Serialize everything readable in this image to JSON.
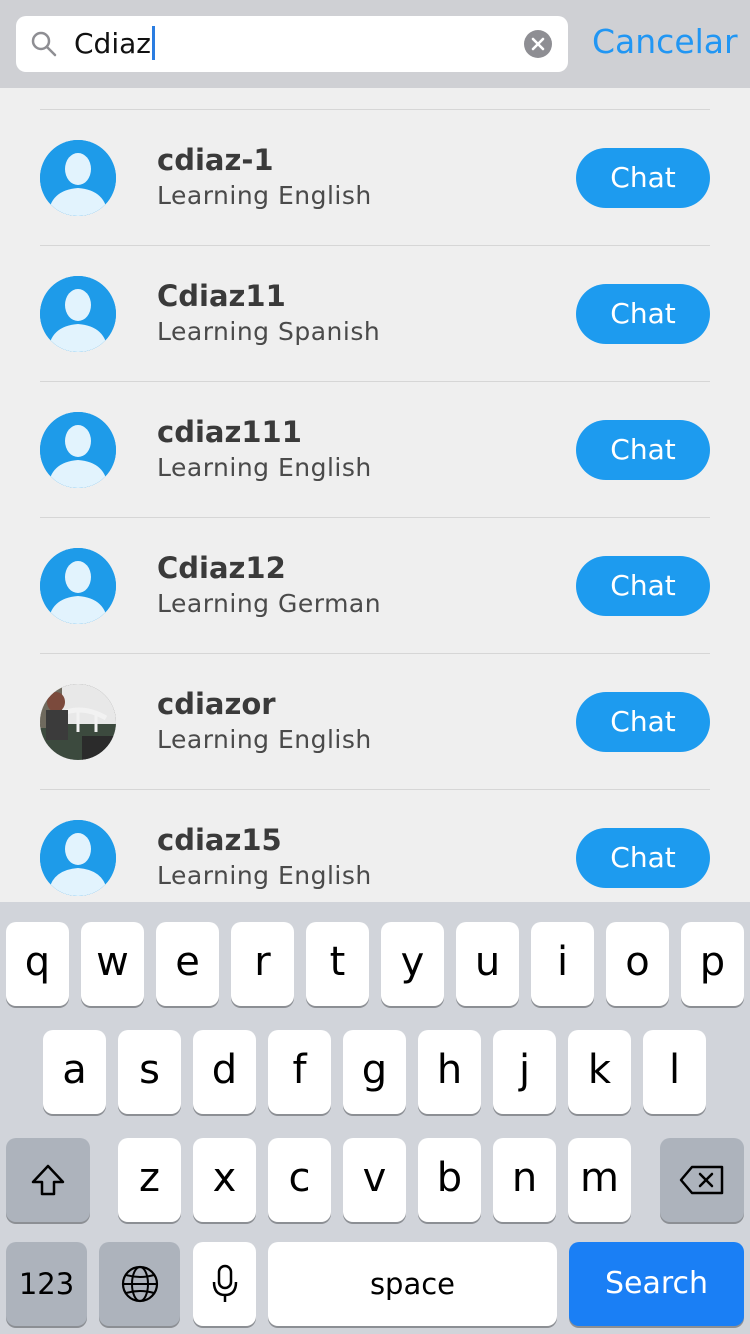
{
  "search": {
    "query": "Cdiaz",
    "cancel_label": "Cancelar"
  },
  "results": [
    {
      "name": "cdiaz-1",
      "learning": "Learning English",
      "chat_label": "Chat",
      "avatar": "default-avatar"
    },
    {
      "name": "Cdiaz11",
      "learning": "Learning Spanish",
      "chat_label": "Chat",
      "avatar": "default-avatar"
    },
    {
      "name": "cdiaz111",
      "learning": "Learning English",
      "chat_label": "Chat",
      "avatar": "default-avatar"
    },
    {
      "name": "Cdiaz12",
      "learning": "Learning German",
      "chat_label": "Chat",
      "avatar": "default-avatar"
    },
    {
      "name": "cdiazor",
      "learning": "Learning English",
      "chat_label": "Chat",
      "avatar": "photo-avatar"
    },
    {
      "name": "cdiaz15",
      "learning": "Learning English",
      "chat_label": "Chat",
      "avatar": "default-avatar"
    }
  ],
  "keyboard": {
    "row1": [
      "q",
      "w",
      "e",
      "r",
      "t",
      "y",
      "u",
      "i",
      "o",
      "p"
    ],
    "row2": [
      "a",
      "s",
      "d",
      "f",
      "g",
      "h",
      "j",
      "k",
      "l"
    ],
    "row3": [
      "z",
      "x",
      "c",
      "v",
      "b",
      "n",
      "m"
    ],
    "numbers_label": "123",
    "space_label": "space",
    "search_label": "Search"
  },
  "colors": {
    "accent": "#2196f3",
    "chat_button": "#1d9bef",
    "search_key": "#1a7ff5"
  }
}
